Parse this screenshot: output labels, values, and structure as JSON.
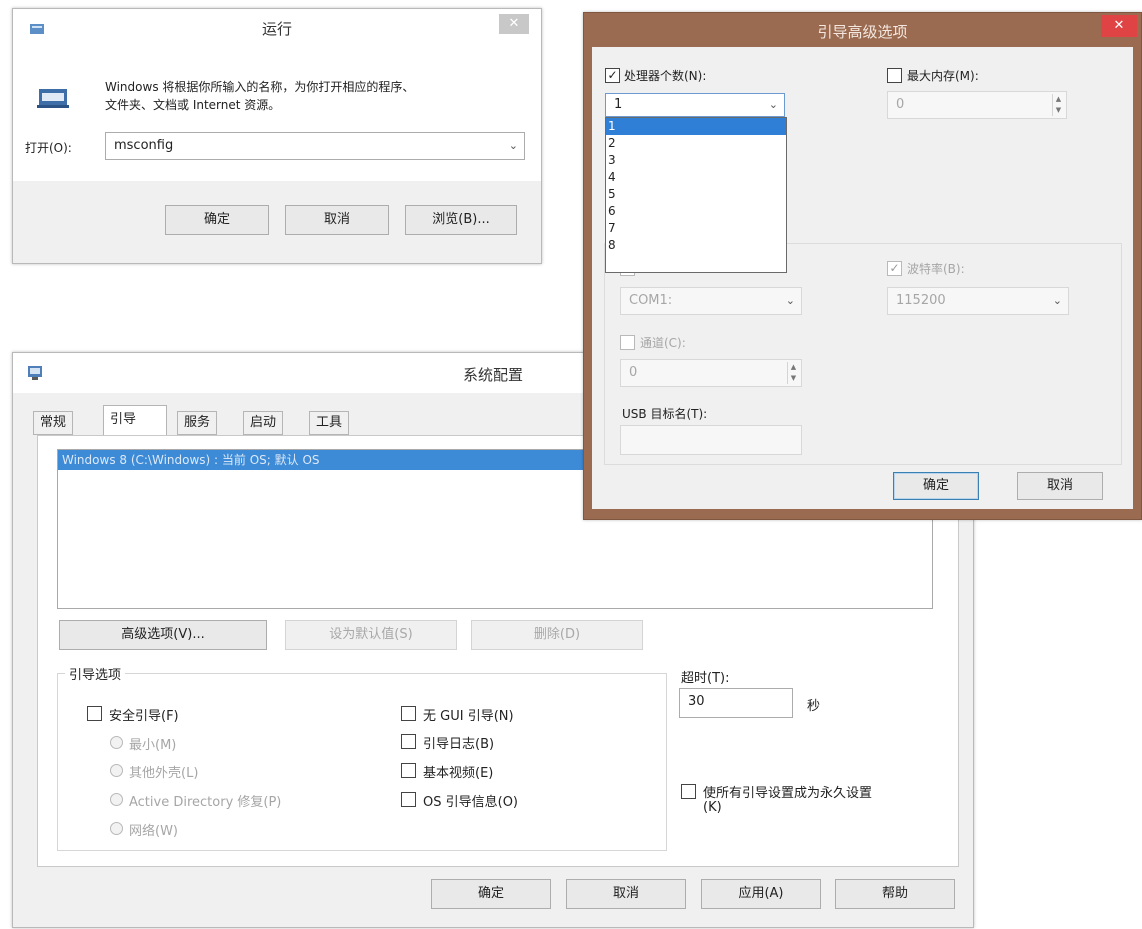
{
  "run_dialog": {
    "title": "运行",
    "description_line1": "Windows 将根据你所输入的名称，为你打开相应的程序、",
    "description_line2": "文件夹、文档或 Internet 资源。",
    "open_label": "打开(O):",
    "open_value": "msconfig",
    "ok": "确定",
    "cancel": "取消",
    "browse": "浏览(B)..."
  },
  "sysconfig": {
    "title": "系统配置",
    "tabs": [
      "常规",
      "引导",
      "服务",
      "启动",
      "工具"
    ],
    "active_tab": 1,
    "boot_entry": "Windows 8 (C:\\Windows) : 当前 OS; 默认 OS",
    "advanced_button": "高级选项(V)...",
    "set_default_button": "设为默认值(S)",
    "delete_button": "删除(D)",
    "boot_options_title": "引导选项",
    "safe_boot": "安全引导(F)",
    "minimal": "最小(M)",
    "alternate_shell": "其他外壳(L)",
    "active_directory": "Active Directory 修复(P)",
    "network": "网络(W)",
    "no_gui_boot": "无 GUI 引导(N)",
    "boot_log": "引导日志(B)",
    "base_video": "基本视频(E)",
    "os_boot_info": "OS 引导信息(O)",
    "timeout_label": "超时(T):",
    "timeout_value": "30",
    "seconds": "秒",
    "make_permanent_line1": "使所有引导设置成为永久设置",
    "make_permanent_line2": "(K)",
    "ok": "确定",
    "cancel": "取消",
    "apply": "应用(A)",
    "help": "帮助"
  },
  "advanced_dialog": {
    "title": "引导高级选项",
    "accent_color": "#9a6b50",
    "close_color": "#e04343",
    "num_processors_label": "处理器个数(N):",
    "num_processors_checked": true,
    "num_processors_value": "1",
    "processor_options": [
      "1",
      "2",
      "3",
      "4",
      "5",
      "6",
      "7",
      "8"
    ],
    "selected_option": "1",
    "max_memory_label": "最大内存(M):",
    "max_memory_checked": false,
    "max_memory_value": "0",
    "debug_port_value": "COM1:",
    "baud_rate_label": "波特率(B):",
    "baud_rate_checked": true,
    "baud_rate_value": "115200",
    "channel_label": "通道(C):",
    "channel_value": "0",
    "usb_target_label": "USB 目标名(T):",
    "ok": "确定",
    "cancel": "取消"
  }
}
